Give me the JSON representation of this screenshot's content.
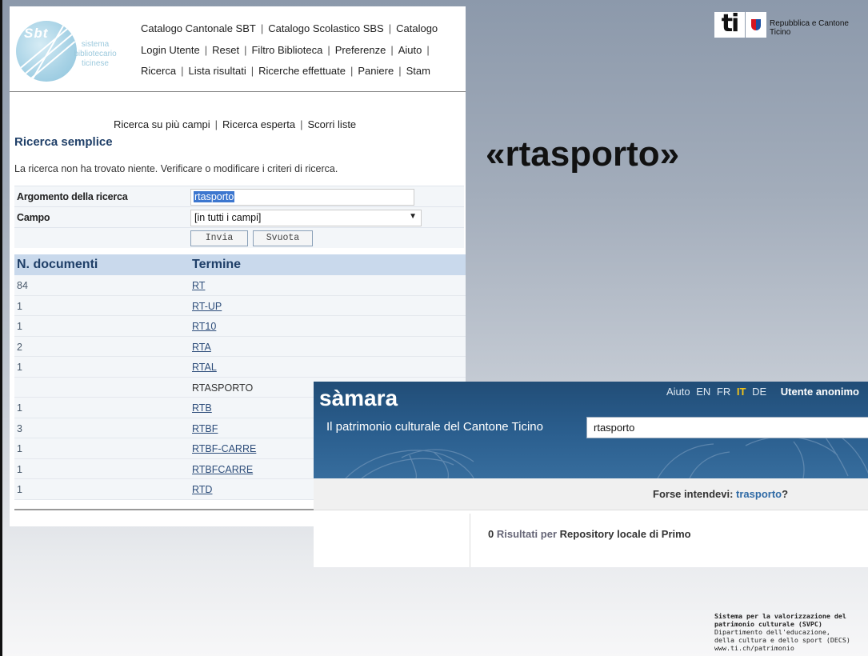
{
  "sbt": {
    "logo": {
      "circle_text": "Sbt",
      "caption_line1": "sistema",
      "caption_line2": "bibliotecario",
      "caption_line3": "ticinese"
    },
    "nav_row1": [
      "Catalogo Cantonale SBT",
      "Catalogo Scolastico SBS",
      "Catalogo"
    ],
    "nav_row2": [
      "Login Utente",
      "Reset",
      "Filtro Biblioteca",
      "Preferenze",
      "Aiuto",
      ""
    ],
    "nav_row3": [
      "Ricerca",
      "Lista risultati",
      "Ricerche effettuate",
      "Paniere",
      "Stam"
    ],
    "subnav": [
      "Ricerca su più campi",
      "Ricerca esperta",
      "Scorri liste"
    ],
    "page_title": "Ricerca semplice",
    "no_results_msg": "La ricerca non ha trovato niente. Verificare o modificare i criteri di ricerca.",
    "form": {
      "argument_label": "Argomento della ricerca",
      "argument_value": "rtasporto",
      "field_label": "Campo",
      "field_value": "[in tutti i campi]",
      "submit_label": "Invia",
      "clear_label": "Svuota"
    },
    "results": {
      "col_count": "N. documenti",
      "col_term": "Termine",
      "rows": [
        {
          "count": "84",
          "term": "RT"
        },
        {
          "count": "1",
          "term": "RT-UP"
        },
        {
          "count": "1",
          "term": "RT10"
        },
        {
          "count": "2",
          "term": "RTA"
        },
        {
          "count": "1",
          "term": "RTAL"
        },
        {
          "count": "",
          "term": "RTASPORTO"
        },
        {
          "count": "1",
          "term": "RTB"
        },
        {
          "count": "3",
          "term": "RTBF"
        },
        {
          "count": "1",
          "term": "RTBF-CARRE"
        },
        {
          "count": "1",
          "term": "RTBFCARRE"
        },
        {
          "count": "1",
          "term": "RTD"
        }
      ]
    }
  },
  "ti_logo": {
    "mark": "ti",
    "line1": "Repubblica e Cantone",
    "line2": "Ticino"
  },
  "big_query": "«rtasporto»",
  "samara": {
    "title": "sàmara",
    "subtitle": "Il patrimonio culturale del Cantone Ticino",
    "search_value": "rtasporto",
    "help": "Aiuto",
    "lang_en": "EN",
    "lang_fr": "FR",
    "lang_it": "IT",
    "lang_de": "DE",
    "user": "Utente anonimo",
    "suggestion_prefix": "Forse intendevi:",
    "suggestion_term": "trasporto",
    "suggestion_suffix": "?",
    "result_count": "0",
    "results_word": "Risultati",
    "per_word": "per",
    "repository": "Repository locale di Primo"
  },
  "footer": {
    "line1": "Sistema per la valorizzazione del",
    "line2": "patrimonio culturale (SVPC)",
    "line3": "Dipartimento dell'educazione,",
    "line4": "della cultura e dello sport (DECS)",
    "line5": "www.ti.ch/patrimonio"
  },
  "colors": {
    "accent_blue": "#1f3f68",
    "samara_header": "#2b5f8f",
    "active_lang": "#f2c31a",
    "selection": "#3d77cf"
  }
}
